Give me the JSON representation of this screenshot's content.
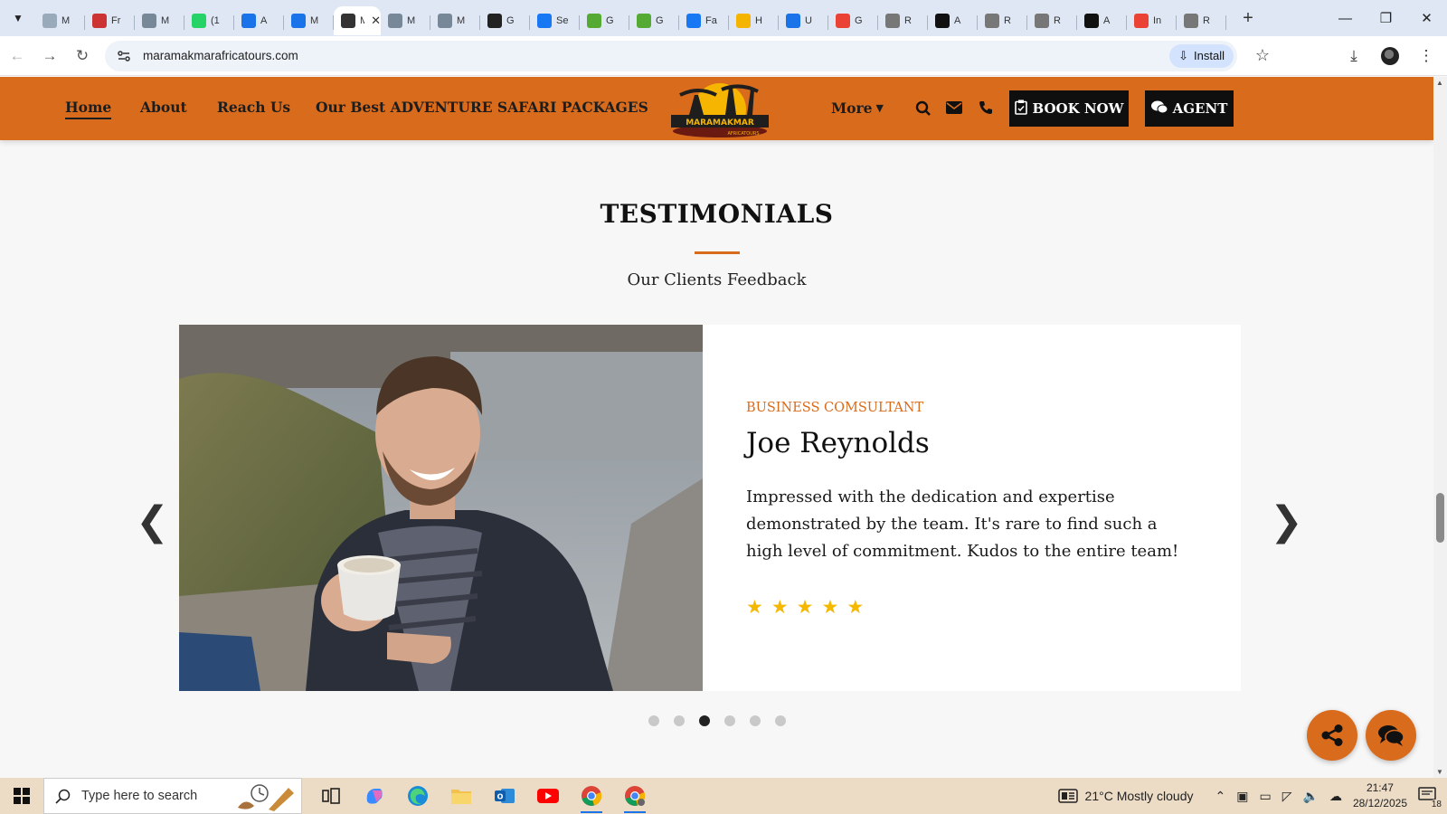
{
  "browser": {
    "tabs": [
      {
        "label": "M",
        "icon": "cloud-icon",
        "color": "#9ab"
      },
      {
        "label": "Fr",
        "icon": "school-icon",
        "color": "#c33"
      },
      {
        "label": "M",
        "icon": "mail-icon",
        "color": "#789"
      },
      {
        "label": "(1",
        "icon": "whatsapp-icon",
        "color": "#25d366"
      },
      {
        "label": "A",
        "icon": "docs-icon",
        "color": "#1a73e8"
      },
      {
        "label": "M",
        "icon": "docs-icon",
        "color": "#1a73e8"
      },
      {
        "label": "M",
        "icon": "site-icon",
        "color": "#333",
        "active": true
      },
      {
        "label": "M",
        "icon": "mail-icon",
        "color": "#789"
      },
      {
        "label": "M",
        "icon": "mail-icon",
        "color": "#789"
      },
      {
        "label": "G",
        "icon": "openai-icon",
        "color": "#222"
      },
      {
        "label": "Se",
        "icon": "facebook-icon",
        "color": "#1877f2"
      },
      {
        "label": "G",
        "icon": "safari-icon",
        "color": "#5a3"
      },
      {
        "label": "G",
        "icon": "safari-icon",
        "color": "#5a3"
      },
      {
        "label": "Fa",
        "icon": "facebook-icon",
        "color": "#1877f2"
      },
      {
        "label": "H",
        "icon": "lightning-icon",
        "color": "#f4b400"
      },
      {
        "label": "U",
        "icon": "chart-icon",
        "color": "#1a73e8"
      },
      {
        "label": "G",
        "icon": "google-icon",
        "color": "#ea4335"
      },
      {
        "label": "R",
        "icon": "rocket-icon",
        "color": "#777"
      },
      {
        "label": "A",
        "icon": "app-icon",
        "color": "#111"
      },
      {
        "label": "R",
        "icon": "rocket-icon",
        "color": "#777"
      },
      {
        "label": "R",
        "icon": "rocket-icon",
        "color": "#777"
      },
      {
        "label": "A",
        "icon": "app-icon",
        "color": "#111"
      },
      {
        "label": "In",
        "icon": "gmail-icon",
        "color": "#ea4335"
      },
      {
        "label": "R",
        "icon": "rocket-icon",
        "color": "#777"
      }
    ],
    "url": "maramakmarafricatours.com",
    "install_label": "Install"
  },
  "site": {
    "nav": {
      "home": "Home",
      "about": "About",
      "reach": "Reach Us",
      "packages": "Our Best ADVENTURE SAFARI PACKAGES",
      "more": "More",
      "book": "BOOK NOW",
      "agent": "AGENT"
    },
    "logo": {
      "name": "MARAMAKMAR",
      "tagline": "AFRICATOURS"
    },
    "brand_color": "#d96b1d",
    "testimonials": {
      "title": "TESTIMONIALS",
      "subtitle": "Our Clients Feedback",
      "role": "BUSINESS COMSULTANT",
      "name": "Joe Reynolds",
      "quote": "Impressed with the dedication and expertise demonstrated by the team. It's rare to find such a high level of commitment. Kudos to the entire team!",
      "rating": 5,
      "slide_count": 6,
      "active_slide": 3
    }
  },
  "taskbar": {
    "search_placeholder": "Type here to search",
    "weather": "21°C  Mostly cloudy",
    "time": "21:47",
    "date": "28/12/2025",
    "notifications": "18"
  }
}
